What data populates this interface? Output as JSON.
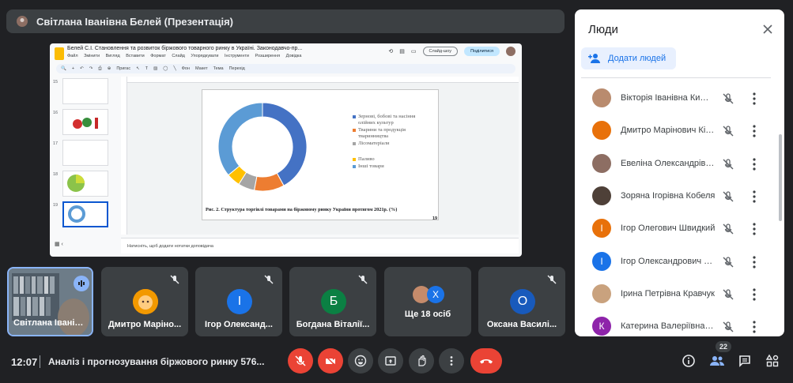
{
  "meeting": {
    "presenter_title": "Світлана Іванівна Белей (Презентація)",
    "time": "12:07",
    "name": "Аналіз і прогнозування біржового ринку 576..."
  },
  "slides_app": {
    "doc_title": "Белей С.І. Становлення та розвиток біржового товарного ринку в Україні. Законодавчо-пр...",
    "menu": [
      "Файл",
      "Змінити",
      "Вигляд",
      "Вставити",
      "Формат",
      "Слайд",
      "Упорядкувати",
      "Інструменти",
      "Розширення",
      "Довідка"
    ],
    "slideshow_label": "Слайд-шоу",
    "share_label": "Поділитися",
    "toolbar": [
      "Пригас",
      "Фон",
      "Макет",
      "Тема",
      "Перехід"
    ],
    "thumb_numbers": [
      "15",
      "16",
      "17",
      "18",
      "19"
    ],
    "notes_placeholder": "Натисніть, щоб додати нотатки доповідача",
    "slide_number": "19"
  },
  "chart_data": {
    "type": "pie",
    "categories": [
      "Зернові, бобові та насіння олійних культур",
      "Тварини та продукція тваринництва",
      "Лісоматеріали",
      "Паливо",
      "Інші товари"
    ],
    "values": [
      42,
      11,
      6,
      5,
      36
    ],
    "colors": [
      "#4472c4",
      "#ed7d31",
      "#a5a5a5",
      "#ffc000",
      "#5b9bd5"
    ],
    "legend_position": "right",
    "caption": "Рис. 2. Структура торгівлі товарами на біржовому ринку України протягом 2021р. (%)"
  },
  "tiles": [
    {
      "name": "Світлана Іванів..."
    },
    {
      "name": "Дмитро Маріно..."
    },
    {
      "name": "Ігор Олександ...",
      "initial": "І",
      "color": "#1a73e8"
    },
    {
      "name": "Богдана Віталії...",
      "initial": "Б",
      "color": "#0b8043"
    },
    {
      "name": "Ще 18 осіб",
      "initial": "Х",
      "color": "#1a73e8"
    },
    {
      "name": "Оксана Василі...",
      "initial": "О",
      "color": "#185abc"
    }
  ],
  "people_panel": {
    "title": "Люди",
    "add_people": "Додати людей",
    "participants_count": "22",
    "people": [
      {
        "name": "Вікторія Іванівна Кифяк",
        "color": "#b98b6e"
      },
      {
        "name": "Дмитро Марінович Кірі...",
        "color": "#e8710a"
      },
      {
        "name": "Евеліна Олександрівн...",
        "color": "#8d6e63"
      },
      {
        "name": "Зоряна Ігорівна Кобеля",
        "color": "#4e4038"
      },
      {
        "name": "Ігор Олегович Швидкий",
        "initial": "І",
        "color": "#e8710a"
      },
      {
        "name": "Ігор Олександрович К...",
        "initial": "І",
        "color": "#1a73e8"
      },
      {
        "name": "Ірина Петрівна Кравчук",
        "color": "#c9a27e"
      },
      {
        "name": "Катерина Валеріївна Р...",
        "initial": "К",
        "color": "#8e24aa"
      }
    ]
  }
}
